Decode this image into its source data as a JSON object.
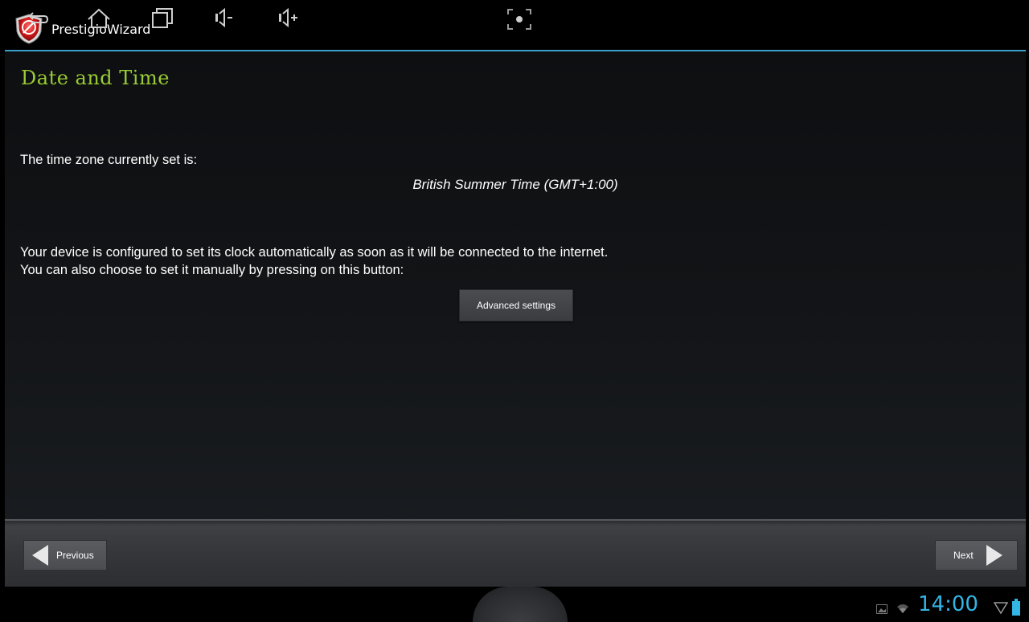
{
  "app": {
    "title": "PrestigioWizard",
    "logo_icon": "prestigio-shield-icon"
  },
  "page": {
    "title": "Date and Time",
    "timezone_label": "The time zone currently set is:",
    "timezone_value": "British Summer Time (GMT+1:00)",
    "auto_clock_text": "Your device is configured to set its clock automatically as soon as it will be connected to the internet.",
    "manual_text": "You can also choose to set it manually by pressing on this button:",
    "advanced_button": "Advanced settings"
  },
  "footer": {
    "previous_label": "Previous",
    "next_label": "Next"
  },
  "system_bar": {
    "icons": [
      "back-icon",
      "home-icon",
      "recent-apps-icon",
      "volume-down-icon",
      "volume-up-icon",
      "screenshot-icon",
      "gallery-notification-icon",
      "wifi-icon",
      "signal-icon",
      "battery-icon"
    ],
    "clock": "14:00"
  },
  "colors": {
    "title_green": "#99cc33",
    "accent_blue": "#33b5e5",
    "divider_blue": "#3aa0c8"
  }
}
